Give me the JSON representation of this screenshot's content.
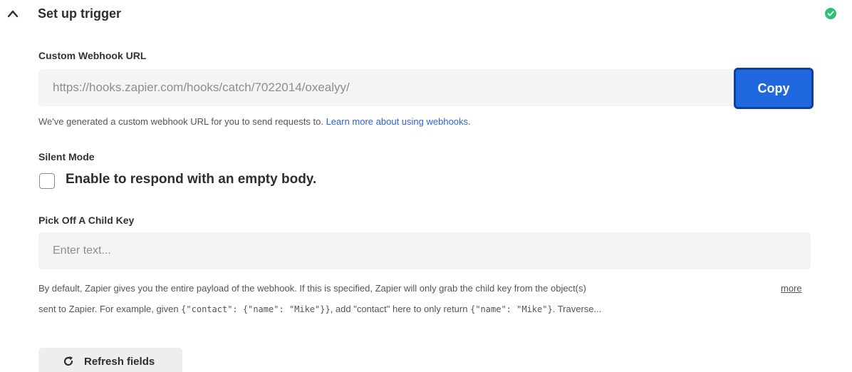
{
  "section": {
    "title": "Set up trigger",
    "collapse_icon": "chevron-up-icon",
    "status_icon": "check-circle-icon",
    "status_color": "#2fbf71"
  },
  "webhook": {
    "label": "Custom Webhook URL",
    "url": "https://hooks.zapier.com/hooks/catch/7022014/oxealyy/",
    "copy_label": "Copy",
    "help_text": "We've generated a custom webhook URL for you to send requests to.",
    "help_link": "Learn more about using webhooks."
  },
  "silent_mode": {
    "label": "Silent Mode",
    "checkbox_label": "Enable to respond with an empty body.",
    "checked": false
  },
  "child_key": {
    "label": "Pick Off A Child Key",
    "placeholder": "Enter text...",
    "value": "",
    "desc_line1": "By default, Zapier gives you the entire payload of the webhook. If this is specified, Zapier will only grab the child key from the object(s)",
    "desc_line2_a": "sent to Zapier. For example, given",
    "desc_line2_code1": "{\"contact\": {\"name\": \"Mike\"}}",
    "desc_line2_b": ", add \"contact\" here to only return",
    "desc_line2_code2": "{\"name\": \"Mike\"}",
    "desc_line2_c": ". Traverse...",
    "more_label": "more"
  },
  "refresh": {
    "label": "Refresh fields",
    "icon": "refresh-icon"
  },
  "colors": {
    "accent": "#1f68e0",
    "link": "#2f63d6"
  }
}
